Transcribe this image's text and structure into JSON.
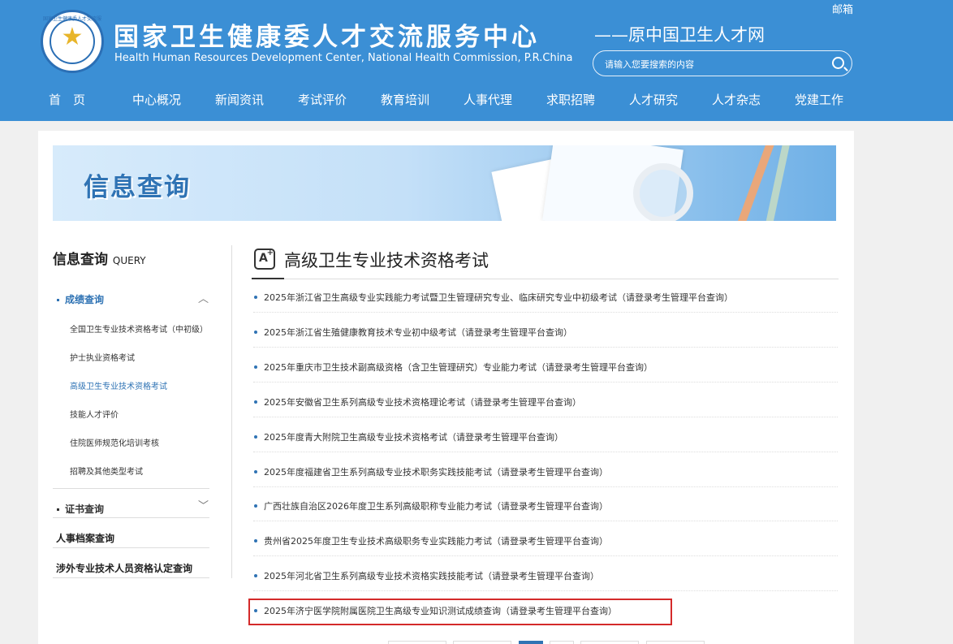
{
  "header": {
    "title_cn": "国家卫生健康委人才交流服务中心",
    "title_en": "Health Human Resources Development Center, National Health Commission, P.R.China",
    "subtitle": "——原中国卫生人才网",
    "mail": "邮箱",
    "search_placeholder": "请输入您要搜索的内容",
    "logo_ring_text": "国家卫生健康委人才交流服务中心"
  },
  "nav": [
    "首　页",
    "中心概况",
    "新闻资讯",
    "考试评价",
    "教育培训",
    "人事代理",
    "求职招聘",
    "人才研究",
    "人才杂志",
    "党建工作"
  ],
  "banner": {
    "title": "信息查询"
  },
  "sidebar": {
    "title": "信息查询",
    "title_en": "QUERY",
    "section1": "成绩查询",
    "items": [
      "全国卫生专业技术资格考试（中初级）",
      "护士执业资格考试",
      "高级卫生专业技术资格考试",
      "技能人才评价",
      "住院医师规范化培训考核",
      "招聘及其他类型考试"
    ],
    "section2": "证书查询",
    "plain1": "人事档案查询",
    "plain2": "涉外专业技术人员资格认定查询"
  },
  "content": {
    "title": "高级卫生专业技术资格考试",
    "icon_letter": "A",
    "icon_plus": "+",
    "items": [
      "2025年浙江省卫生高级专业实践能力考试暨卫生管理研究专业、临床研究专业中初级考试（请登录考生管理平台查询）",
      "2025年浙江省生殖健康教育技术专业初中级考试（请登录考生管理平台查询）",
      "2025年重庆市卫生技术副高级资格（含卫生管理研究）专业能力考试（请登录考生管理平台查询）",
      "2025年安徽省卫生系列高级专业技术资格理论考试（请登录考生管理平台查询）",
      "2025年度青大附院卫生高级专业技术资格考试（请登录考生管理平台查询）",
      "2025年度福建省卫生系列高级专业技术职务实践技能考试（请登录考生管理平台查询）",
      "广西壮族自治区2026年度卫生系列高级职称专业能力考试（请登录考生管理平台查询）",
      "贵州省2025年度卫生专业技术高级职务专业实践能力考试（请登录考生管理平台查询）",
      "2025年河北省卫生系列高级专业技术资格实践技能考试（请登录考生管理平台查询）",
      "2025年济宁医学院附属医院卫生高级专业知识测试成绩查询（请登录考生管理平台查询）"
    ]
  },
  "colors": {
    "header": "#3b8fd5",
    "accent": "#2f73b4",
    "highlight": "#d42a2a"
  }
}
